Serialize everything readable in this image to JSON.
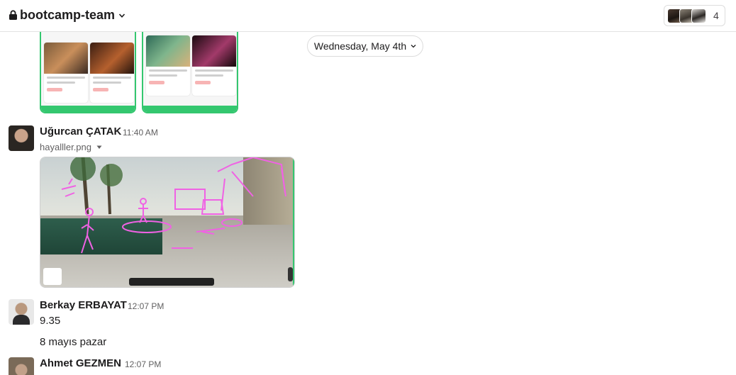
{
  "header": {
    "channel_name": "bootcamp-team",
    "member_count": "4",
    "icons": [
      "lock-icon",
      "chevron-down-icon"
    ]
  },
  "date_divider": {
    "label": "Wednesday, May 4th"
  },
  "messages": [
    {
      "sender": "Uğurcan ÇATAK",
      "time": "11:40 AM",
      "attachment": {
        "file_name": "hayalller.png"
      }
    },
    {
      "sender": "Berkay ERBAYAT",
      "time": "12:07 PM",
      "lines": [
        "9.35",
        "8 mayıs pazar"
      ]
    },
    {
      "sender": "Ahmet GEZMEN",
      "time": "12:07 PM"
    }
  ],
  "colors": {
    "accent_green": "#34c76f",
    "annotation_pink": "#f062e4",
    "text_primary": "#1d1c1d",
    "text_secondary": "#616061"
  }
}
